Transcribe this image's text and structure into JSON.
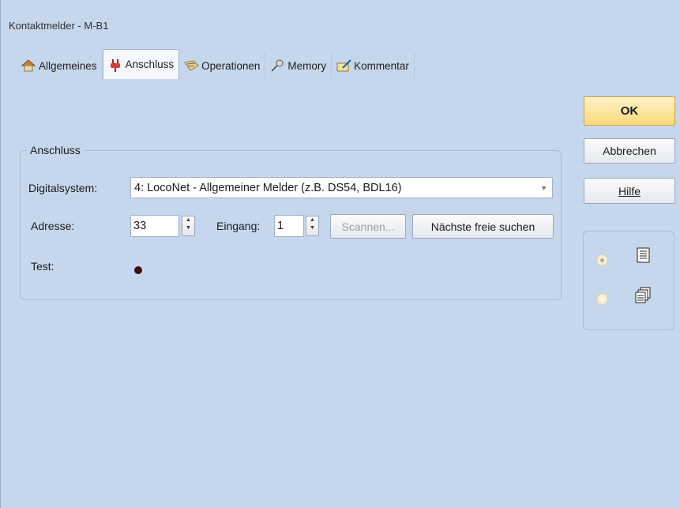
{
  "window": {
    "title": "Kontaktmelder - M-B1"
  },
  "tabs": [
    {
      "label": "Allgemeines",
      "icon": "house-icon"
    },
    {
      "label": "Anschluss",
      "icon": "plug-icon"
    },
    {
      "label": "Operationen",
      "icon": "operations-icon"
    },
    {
      "label": "Memory",
      "icon": "pin-icon"
    },
    {
      "label": "Kommentar",
      "icon": "notepad-icon"
    }
  ],
  "buttons": {
    "ok": "OK",
    "cancel": "Abbrechen",
    "help": "Hilfe"
  },
  "group": {
    "title": "Anschluss",
    "digital_label": "Digitalsystem:",
    "digital_value": "4: LocoNet - Allgemeiner Melder (z.B. DS54, BDL16)",
    "address_label": "Adresse:",
    "address_value": "33",
    "input_label": "Eingang:",
    "input_value": "1",
    "scan_label": "Scannen...",
    "next_free_label": "Nächste freie suchen",
    "test_label": "Test:"
  },
  "colors": {
    "accent_ok": "#fbd97a",
    "background": "#c6d7ed",
    "test_indicator": "#3d1010"
  }
}
